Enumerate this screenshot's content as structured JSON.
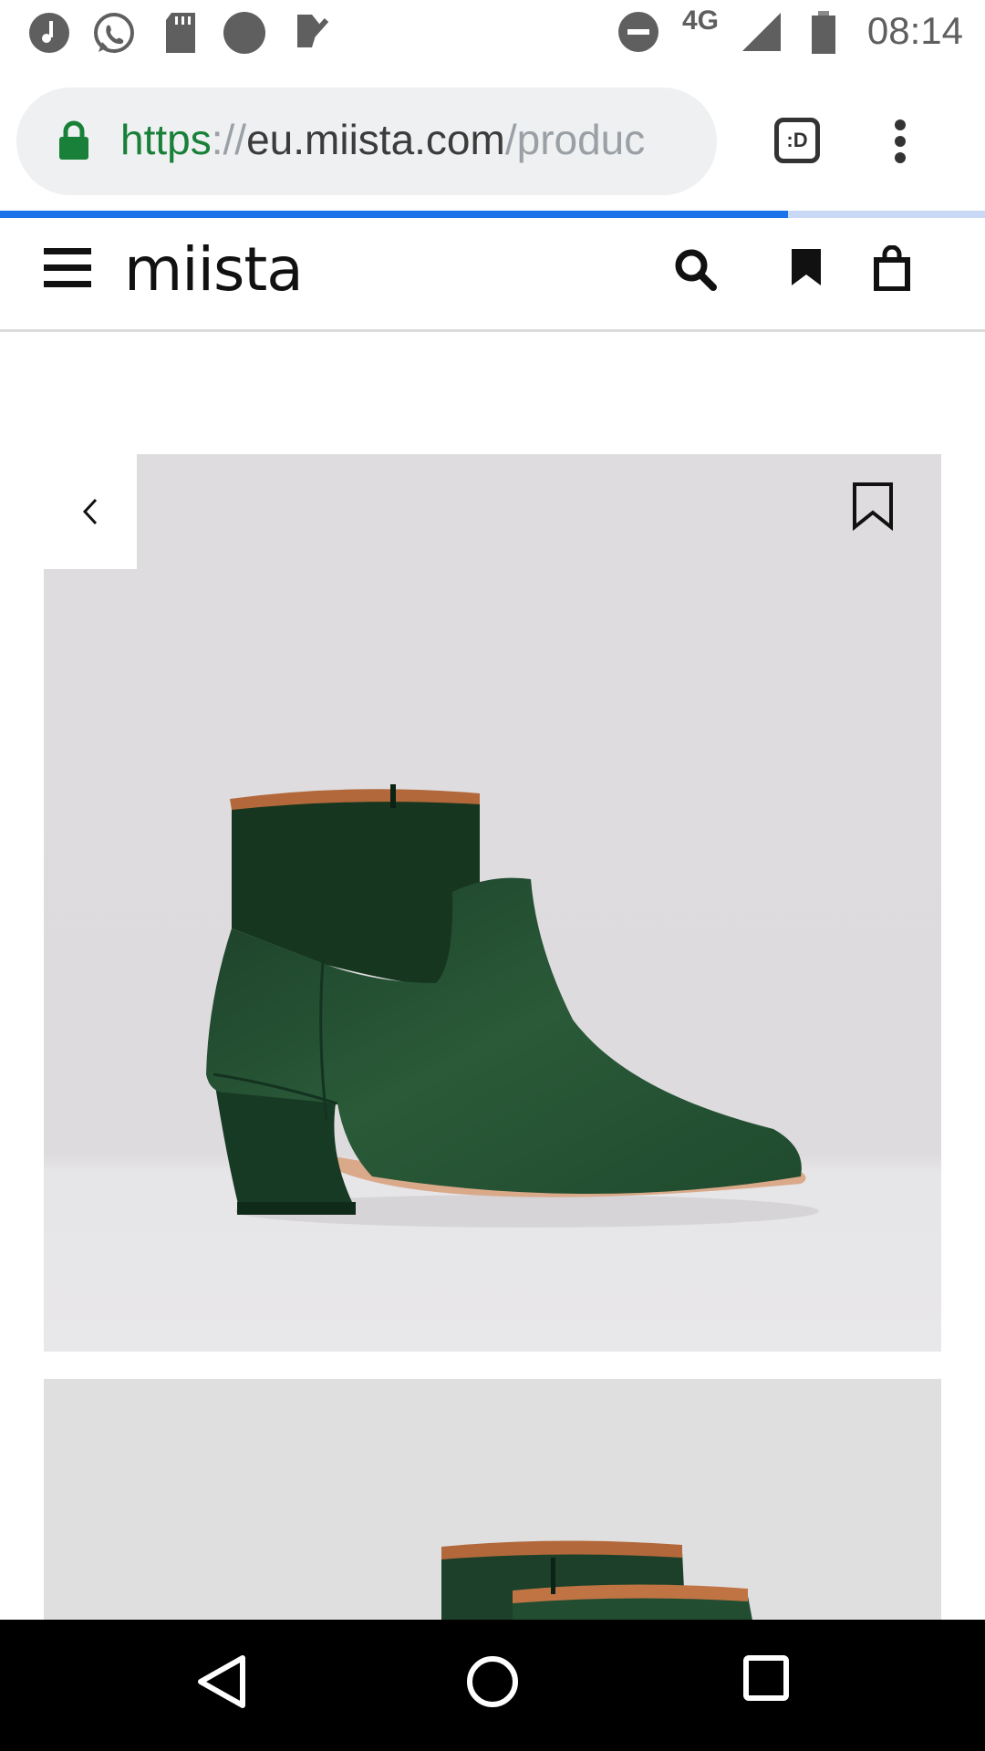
{
  "status_bar": {
    "time": "08:14",
    "network": "4G",
    "left_icons": [
      "music-icon",
      "whatsapp-icon",
      "sd-card-icon",
      "circle-icon",
      "task-check-icon"
    ],
    "right_icons": [
      "do-not-disturb-icon",
      "signal-icon",
      "battery-icon"
    ]
  },
  "browser": {
    "url_scheme": "https",
    "url_sep": "://",
    "url_host": "eu.miista.com",
    "url_path": "/produc",
    "tab_switcher_label": ":D",
    "load_progress": 0.8
  },
  "site": {
    "logo": "miista",
    "icons": [
      "hamburger-icon",
      "search-icon",
      "bookmark-icon",
      "shopping-bag-icon"
    ]
  },
  "product": {
    "image_description_icons": [
      "chevron-left-icon",
      "wishlist-bookmark-icon"
    ]
  },
  "colors": {
    "accent": "#1a73e8",
    "secure_green": "#188038",
    "image_bg": "#e0dfe0",
    "boot_green": "#1f4a2e"
  }
}
